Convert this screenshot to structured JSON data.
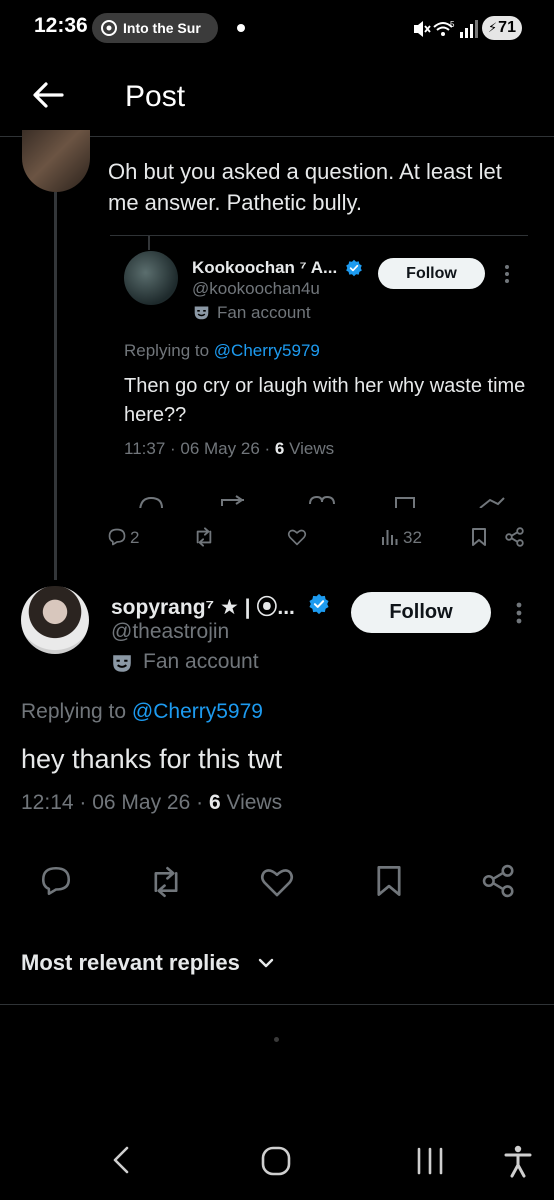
{
  "status_bar": {
    "time": "12:36",
    "media_title": "Into the Sur",
    "battery": "71"
  },
  "header": {
    "title": "Post"
  },
  "parent_post": {
    "text": "Oh but you asked a question. At least let me answer. Pathetic bully."
  },
  "quoted_post": {
    "display_name": "Kookoochan ⁷ A...",
    "handle": "@kookoochan4u",
    "label": "Fan account",
    "follow_label": "Follow",
    "replying_prefix": "Replying to ",
    "replying_to": "@Cherry5979",
    "text": "Then go cry or laugh with her why waste time here??",
    "timestamp": "11:37 · 06 May 26 · ",
    "views_count": "6",
    "views_label": " Views"
  },
  "parent_actions": {
    "replies": "2",
    "views": "32"
  },
  "reply_post": {
    "display_name": "sopyrang⁷ ★ | ⦿...",
    "handle": "@theastrojin",
    "label": "Fan account",
    "follow_label": "Follow",
    "replying_prefix": "Replying to ",
    "replying_to": "@Cherry5979",
    "text": "hey thanks for this twt",
    "timestamp": "12:14 · 06 May 26 · ",
    "views_count": "6",
    "views_label": " Views"
  },
  "replies_sort": {
    "label": "Most relevant replies"
  },
  "colors": {
    "background": "#000000",
    "text": "#e7e9ea",
    "secondary_text": "#71767b",
    "link": "#1d9bf0",
    "verified_badge": "#1d9bf0"
  },
  "icons": [
    "back-arrow-icon",
    "reply-icon",
    "repost-icon",
    "like-icon",
    "views-icon",
    "bookmark-icon",
    "share-icon",
    "verified-badge-icon",
    "fan-account-mask-icon",
    "more-options-icon",
    "chevron-down-icon",
    "nav-back-icon",
    "nav-home-icon",
    "nav-recents-icon",
    "accessibility-icon"
  ]
}
